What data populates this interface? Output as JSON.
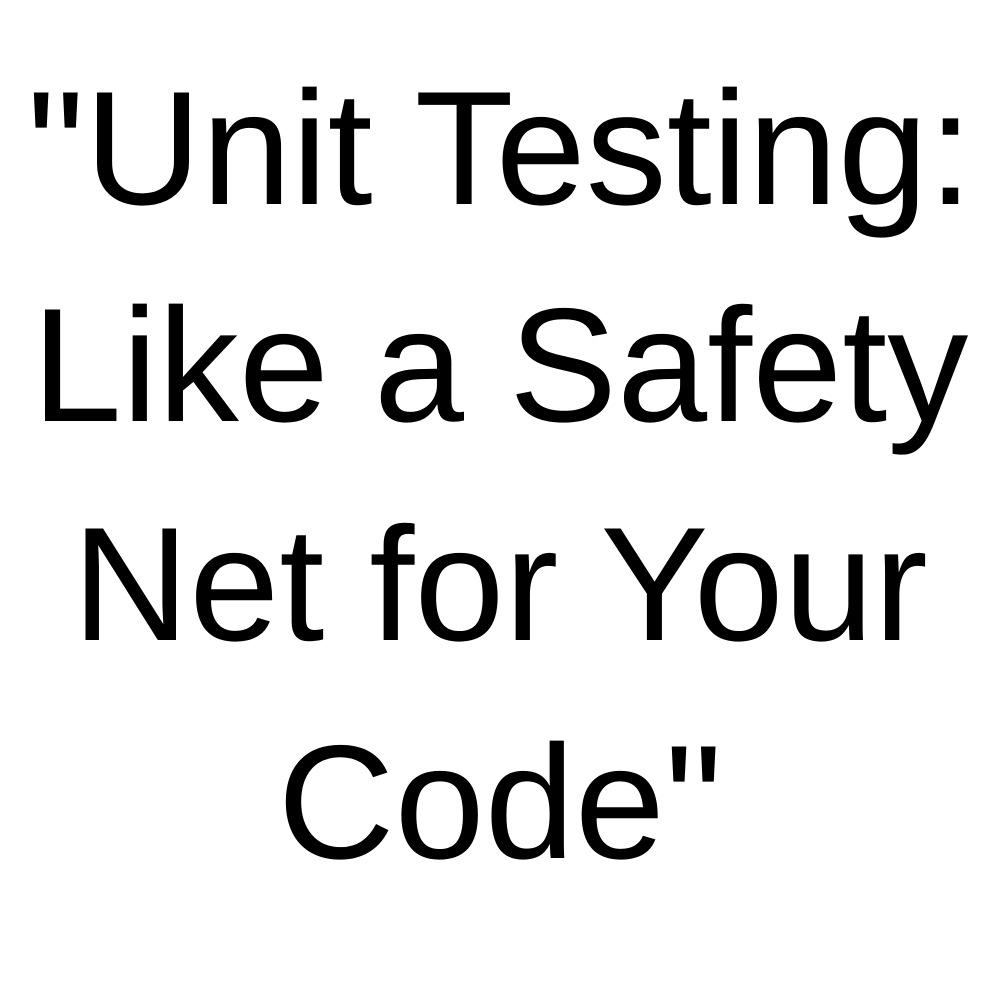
{
  "quote": {
    "lines": [
      "\"Unit Testing:",
      "Like a Safety",
      "Net for Your",
      "Code\""
    ]
  },
  "colors": {
    "background": "#ffffff",
    "text": "#000000"
  }
}
